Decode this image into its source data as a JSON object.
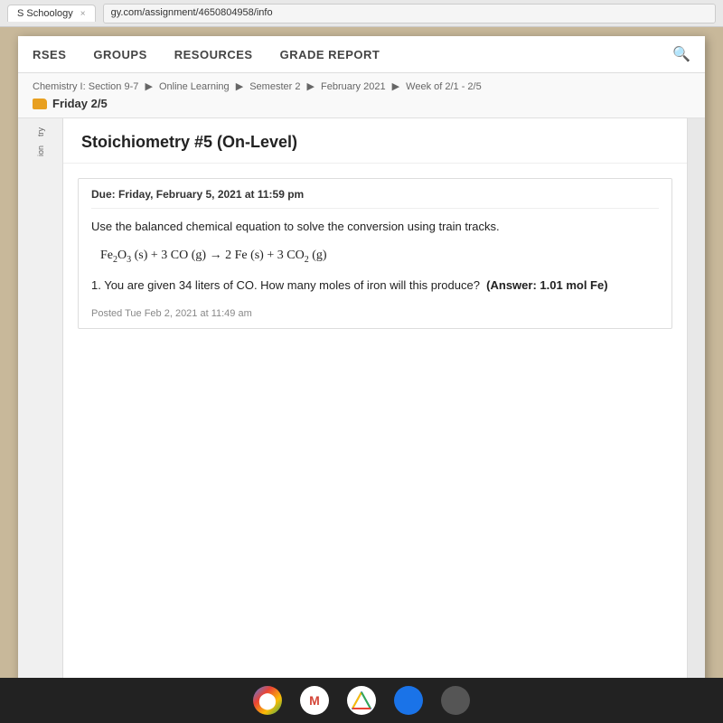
{
  "browser": {
    "tab_label": "S Schoology",
    "close_label": "×",
    "address": "gy.com/assignment/4650804958/info"
  },
  "nav": {
    "items": [
      "RSES",
      "GROUPS",
      "RESOURCES",
      "GRADE REPORT"
    ],
    "sidebar_labels": [
      "try",
      "ion"
    ]
  },
  "breadcrumb": {
    "path": [
      "Chemistry I: Section 9-7",
      "Online Learning",
      "Semester 2",
      "February 2021",
      "Week of 2/1 - 2/5"
    ],
    "separators": [
      "▶",
      "▶",
      "▶",
      "▶"
    ],
    "week_label": "Friday 2/5"
  },
  "assignment": {
    "title": "Stoichiometry #5 (On-Level)",
    "due_date": "Due: Friday, February 5, 2021 at 11:59 pm",
    "instruction": "Use the balanced chemical equation to solve the conversion using train tracks.",
    "equation_text": "Fe₂O₃ (s) + 3 CO (g) → 2 Fe (s) + 3 CO₂ (g)",
    "question": "1. You are given 34 liters of CO. How many moles of iron will this produce?",
    "answer_label": "(Answer: 1.01 mol Fe)",
    "posted": "Posted Tue Feb 2, 2021 at 11:49 am"
  },
  "taskbar": {
    "icons": [
      "🔵",
      "M",
      "▲",
      "🟦",
      "⬛"
    ]
  }
}
